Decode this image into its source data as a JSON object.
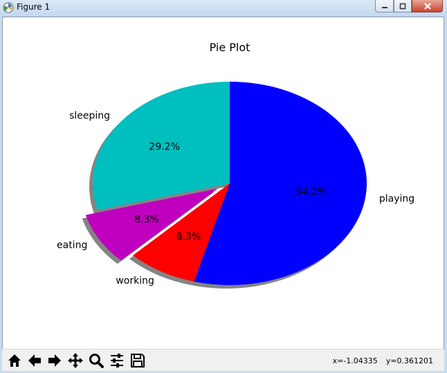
{
  "window": {
    "title": "Figure 1"
  },
  "toolbar": {
    "buttons": [
      "home-icon",
      "back-icon",
      "forward-icon",
      "pan-icon",
      "zoom-icon",
      "configure-icon",
      "save-icon"
    ],
    "coord_x": "x=-1.04335",
    "coord_y": "y=0.361201"
  },
  "chart_data": {
    "type": "pie",
    "title": "Pie Plot",
    "slices": [
      {
        "label": "playing",
        "value": 54.2,
        "pct_label": "54.2%",
        "color": "#0000ff",
        "explode": 0
      },
      {
        "label": "working",
        "value": 8.3,
        "pct_label": "8.3%",
        "color": "#ff0000",
        "explode": 0
      },
      {
        "label": "eating",
        "value": 8.3,
        "pct_label": "8.3%",
        "color": "#bf00bf",
        "explode": 0.1
      },
      {
        "label": "sleeping",
        "value": 29.2,
        "pct_label": "29.2%",
        "color": "#00bfbf",
        "explode": 0
      }
    ],
    "start_angle": 90,
    "direction": "clockwise",
    "shadow": true
  }
}
